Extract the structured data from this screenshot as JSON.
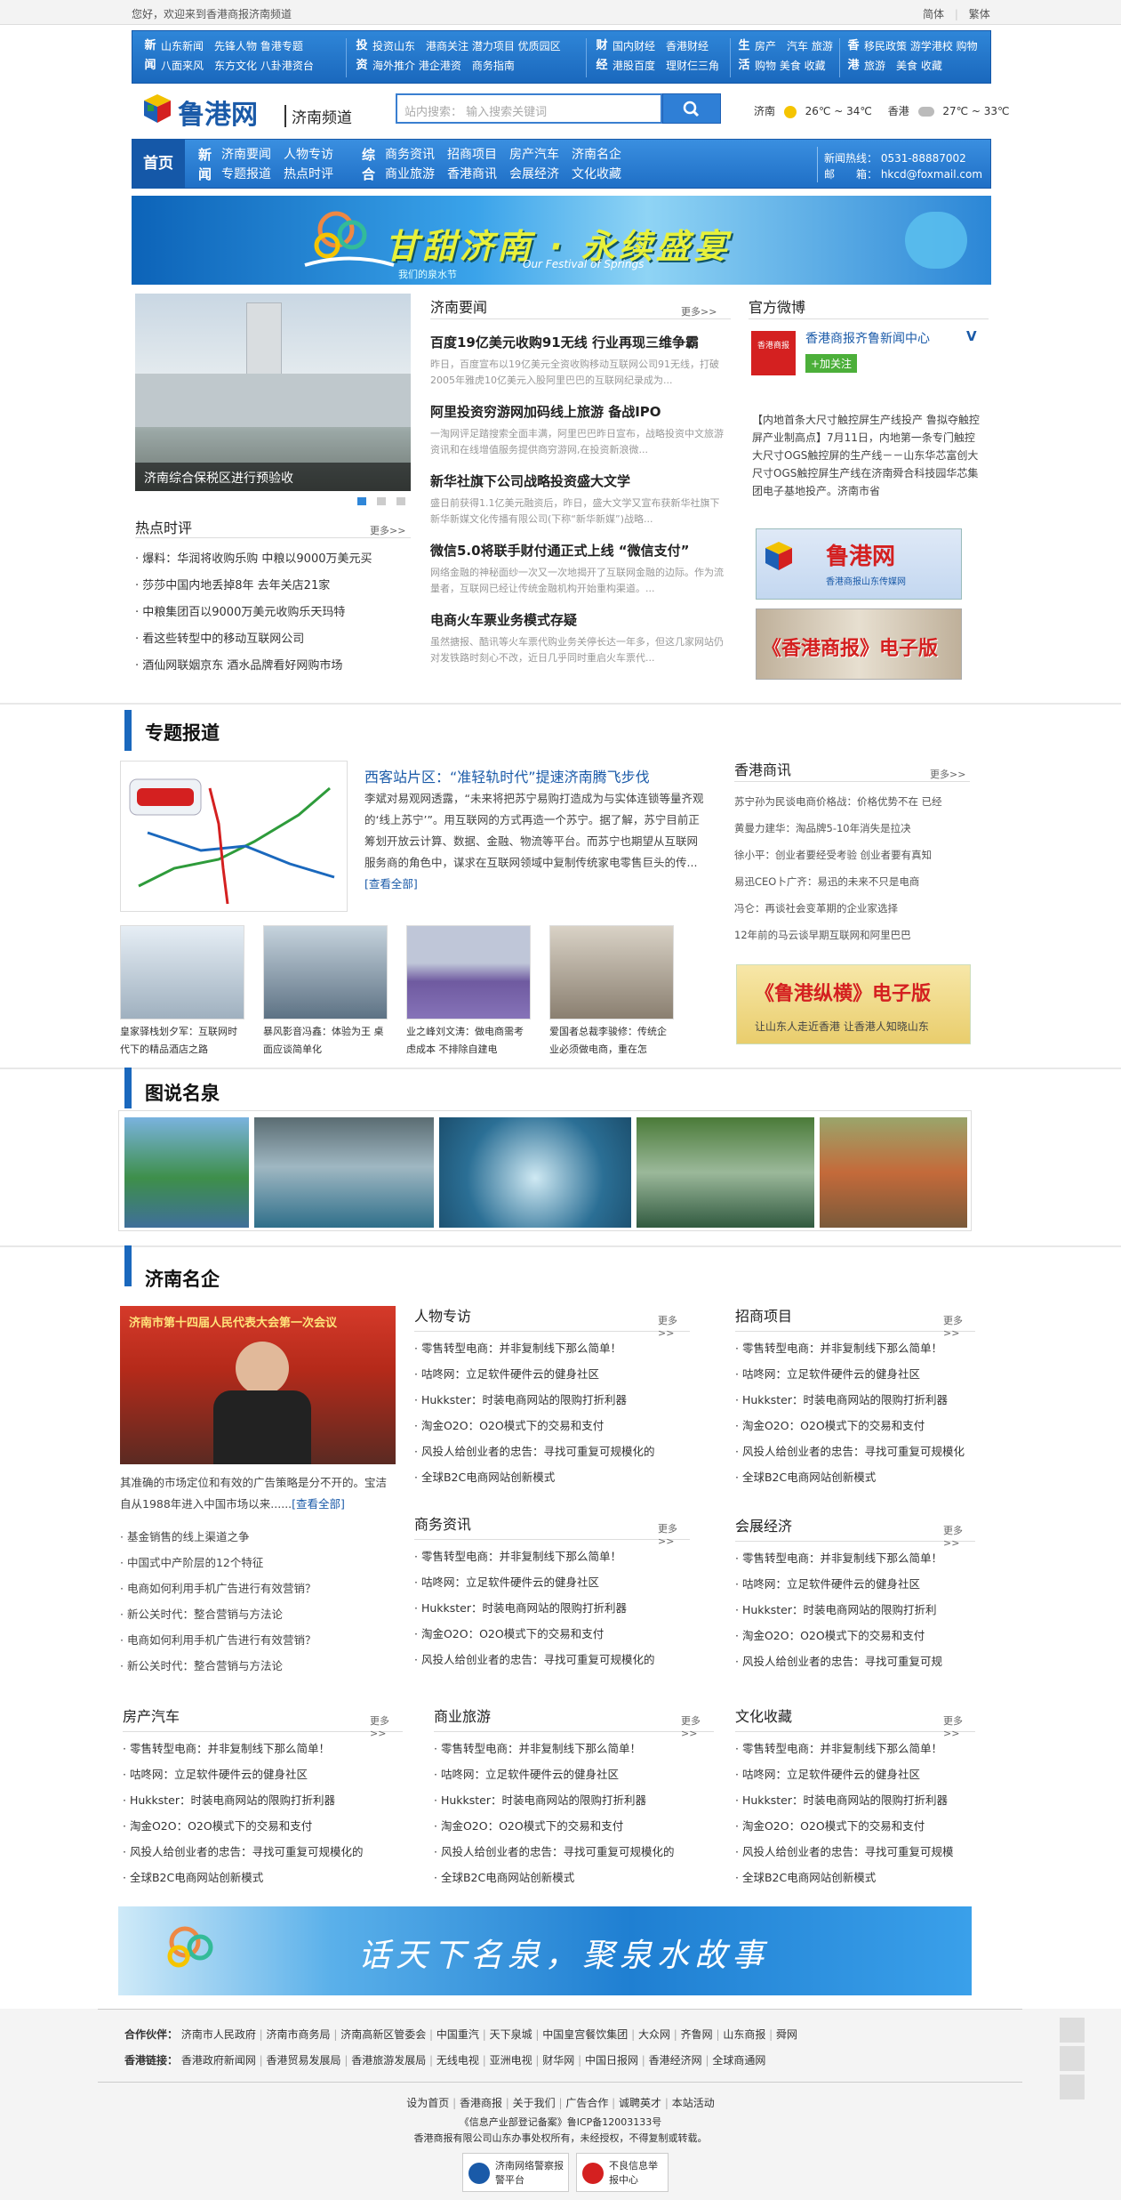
{
  "top": {
    "greeting": "您好，欢迎来到香港商报济南频道",
    "simp": "简体",
    "trad": "繁体"
  },
  "nav": {
    "g1": {
      "k1": "新",
      "k2": "闻",
      "row1": "山东新闻　先锋人物  鲁港专题",
      "row2": "八面来风　东方文化  八卦港资台"
    },
    "g2": {
      "k1": "投",
      "k2": "资",
      "row1": "投资山东　港商关注  潜力项目  优质园区",
      "row2": "海外推介  港企港资　商务指南"
    },
    "g3": {
      "k1": "财",
      "k2": "经",
      "row1": "国内财经　香港财经",
      "row2": "港股百度　理财仨三角"
    },
    "g4": {
      "k1": "生",
      "k2": "活",
      "row1": "房产　汽车  旅游",
      "row2": "购物  美食  收藏"
    },
    "g5": {
      "k1": "香",
      "k2": "港",
      "row1": "移民政策  游学港校  购物",
      "row2": "旅游　美食  收藏"
    }
  },
  "logo": {
    "name": "鲁港网",
    "channel": "济南频道"
  },
  "search": {
    "placeholder": "站内搜索：  输入搜索关键词"
  },
  "weather": {
    "city1": "济南",
    "temp1": "26℃ ~ 34℃",
    "city2": "香港",
    "temp2": "27℃ ~ 33℃"
  },
  "mainnav": {
    "home": "首页",
    "k1": "新",
    "k2": "闻",
    "r1a": "济南要闻",
    "r1b": "人物专访",
    "r2a": "专题报道",
    "r2b": "热点时评",
    "k3": "综",
    "k4": "合",
    "r1c": "商务资讯",
    "r1d": "招商项目",
    "r1e": "房产汽车",
    "r1f": "济南名企",
    "r2c": "商业旅游",
    "r2d": "香港商讯",
    "r2e": "会展经济",
    "r2f": "文化收藏",
    "hotline": "新闻热线：  0531-88887002",
    "email": "邮　　箱：  hkcd@foxmail.com"
  },
  "banner1": {
    "title": "甘甜济南 · 永续盛宴",
    "sub": "Our Festival of Springs",
    "small": "我们的泉水节",
    "logo": "泉水节"
  },
  "photo": {
    "caption": "济南综合保税区进行预验收"
  },
  "news": {
    "title": "济南要闻",
    "more": "更多>>",
    "items": [
      {
        "t": "百度19亿美元收购91无线 行业再现三维争霸",
        "s": "昨日，百度宣布以19亿美元全资收购移动互联网公司91无线，打破2005年雅虎10亿美元入股阿里巴巴的互联网纪录成为..."
      },
      {
        "t": "阿里投资穷游网加码线上旅游 备战IPO",
        "s": "一淘网评足踏搜索全面丰满，阿里巴巴昨日宣布，战略投资中文旅游资讯和在线增值服务提供商穷游网,在投资新浪微..."
      },
      {
        "t": "新华社旗下公司战略投资盛大文学",
        "s": "盛日前获得1.1亿美元融资后，昨日，盛大文学又宣布获新华社旗下新华新媒文化传播有限公司(下称“新华新媒”)战略..."
      },
      {
        "t": "微信5.0将联手财付通正式上线 “微信支付”",
        "s": "网络金融的神秘面纱一次又一次地揭开了互联网金融的边际。作为流量者，互联网已经让传统金融机构开始重构渠道。..."
      },
      {
        "t": "电商火车票业务模式存疑",
        "s": "虽然搪报、酷讯等火车票代购业务关停长达一年多，但这几家网站仍对发铁路时刻心不改，近日几乎同时重启火车票代..."
      }
    ]
  },
  "weibo": {
    "title": "官方微博",
    "name": "香港商报齐鲁新闻中心",
    "follow": "+加关注",
    "avatar": "香港商报",
    "text": "【内地首条大尺寸触控屏生产线投产 鲁拟夺触控屏产业制高点】7月11日，内地第一条专门触控大尺寸OGS触控屏的生产线－－山东华芯富创大尺寸OGS触控屏生产线在济南舜合科技园华芯集团电子基地投产。济南市省",
    "banner_a": "鲁港网",
    "banner_a_sub": "香港商报山东传媒网",
    "banner_b": "《香港商报》电子版"
  },
  "hot": {
    "title": "热点时评",
    "more": "更多>>",
    "items": [
      "爆料：华润将收购乐购 中粮以9000万美元买",
      "莎莎中国内地丢掉8年 去年关店21家",
      "中粮集团百以9000万美元收购乐天玛特",
      "看这些转型中的移动互联网公司",
      "酒仙网联姻京东 酒水品牌看好网购市场"
    ]
  },
  "special": {
    "title": "专题报道",
    "headline": "西客站片区：“准轻轨时代”提速济南腾飞步伐",
    "body": "李斌对易观网透露，“未来将把苏宁易购打造成为与实体连锁等量齐观的‘线上苏宁’”。用互联网的方式再造一个苏宁。据了解，苏宁目前正筹划开放云计算、数据、金融、物流等平台。而苏宁也期望从互联网服务商的角色中，谋求在互联网领域中复制传统家电零售巨头的传...",
    "readall": "[查看全部]",
    "thumbs": [
      "皇家驿栈划夕军：互联网时代下的精品酒店之路",
      "暴风影音冯鑫：体验为王 桌面应谈简单化",
      "业之峰刘文涛：做电商需考虑成本 不排除自建电",
      "爱国者总裁李骏修：传统企业必须做电商，重在怎"
    ]
  },
  "hkinfo": {
    "title": "香港商讯",
    "more": "更多>>",
    "items": [
      "苏宁孙为民谈电商价格战：价格优势不在 已经",
      "黄曼力建华：淘品牌5-10年消失是拉决",
      "徐小平：创业者要经受考验 创业者要有真知",
      "易迅CEO卜广齐：易迅的未来不只是电商",
      "冯仑：再谈社会变革期的企业家选择",
      "12年前的马云谈早期互联网和阿里巴巴"
    ],
    "ebanner": "《鲁港纵横》电子版",
    "ebanner_sub": "让山东人走近香港 让香港人知晓山东"
  },
  "springs": {
    "title": "图说名泉"
  },
  "enterprise": {
    "title": "济南名企",
    "body": "其准确的市场定位和有效的广告策略是分不开的。宝洁自从1988年进入中国市场以来......",
    "readall": "[查看全部]",
    "items": [
      "基金销售的线上渠道之争",
      "中国式中产阶层的12个特征",
      "电商如何利用手机广告进行有效营销？",
      "新公关时代：整合营销与方法论",
      "电商如何利用手机广告进行有效营销？",
      "新公关时代：整合营销与方法论"
    ],
    "bannerText": "济南市第十四届人民代表大会第一次会议"
  },
  "cols": {
    "people": {
      "title": "人物专访",
      "more": "更多>>",
      "items": [
        "零售转型电商：并非复制线下那么简单！",
        "咕咚网：立足软件硬件云的健身社区",
        "Hukkster：时装电商网站的限购打折利器",
        "淘金O2O：O2O模式下的交易和支付",
        "风投人给创业者的忠告：寻找可重复可规模化的",
        "全球B2C电商网站创新模式"
      ]
    },
    "invest": {
      "title": "招商项目",
      "more": "更多>>",
      "items": [
        "零售转型电商：并非复制线下那么简单！",
        "咕咚网：立足软件硬件云的健身社区",
        "Hukkster：时装电商网站的限购打折利器",
        "淘金O2O：O2O模式下的交易和支付",
        "风投人给创业者的忠告：寻找可重复可规模化",
        "全球B2C电商网站创新模式"
      ]
    },
    "biz": {
      "title": "商务资讯",
      "more": "更多>>",
      "items": [
        "零售转型电商：并非复制线下那么简单！",
        "咕咚网：立足软件硬件云的健身社区",
        "Hukkster：时装电商网站的限购打折利器",
        "淘金O2O：O2O模式下的交易和支付",
        "风投人给创业者的忠告：寻找可重复可规模化的"
      ]
    },
    "expo": {
      "title": "会展经济",
      "more": "更多>>",
      "items": [
        "零售转型电商：并非复制线下那么简单！",
        "咕咚网：立足软件硬件云的健身社区",
        "Hukkster：时装电商网站的限购打折利",
        "淘金O2O：O2O模式下的交易和支付",
        "风投人给创业者的忠告：寻找可重复可规"
      ]
    },
    "estate": {
      "title": "房产汽车",
      "more": "更多>>",
      "items": [
        "零售转型电商：并非复制线下那么简单！",
        "咕咚网：立足软件硬件云的健身社区",
        "Hukkster：时装电商网站的限购打折利器",
        "淘金O2O：O2O模式下的交易和支付",
        "风投人给创业者的忠告：寻找可重复可规模化的",
        "全球B2C电商网站创新模式"
      ]
    },
    "travel": {
      "title": "商业旅游",
      "more": "更多>>",
      "items": [
        "零售转型电商：并非复制线下那么简单！",
        "咕咚网：立足软件硬件云的健身社区",
        "Hukkster：时装电商网站的限购打折利器",
        "淘金O2O：O2O模式下的交易和支付",
        "风投人给创业者的忠告：寻找可重复可规模化的",
        "全球B2C电商网站创新模式"
      ]
    },
    "culture": {
      "title": "文化收藏",
      "more": "更多>>",
      "items": [
        "零售转型电商：并非复制线下那么简单！",
        "咕咚网：立足软件硬件云的健身社区",
        "Hukkster：时装电商网站的限购打折利器",
        "淘金O2O：O2O模式下的交易和支付",
        "风投人给创业者的忠告：寻找可重复可规模",
        "全球B2C电商网站创新模式"
      ]
    }
  },
  "banner2": {
    "text": "话天下名泉，聚泉水故事"
  },
  "partners": {
    "label1": "合作伙伴：",
    "links1": [
      "济南市人民政府",
      "济南市商务局",
      "济南高新区管委会",
      "中国重汽",
      "天下泉城",
      "中国皇宫餐饮集团",
      "大众网",
      "齐鲁网",
      "山东商报",
      "舜网"
    ],
    "label2": "香港链接：",
    "links2": [
      "香港政府新闻网",
      "香港贸易发展局",
      "香港旅游发展局",
      "无线电视",
      "亚洲电视",
      "财华网",
      "中国日报网",
      "香港经济网",
      "全球商通网"
    ]
  },
  "footer": {
    "links": [
      "设为首页",
      "香港商报",
      "关于我们",
      "广告合作",
      "诚聘英才",
      "本站活动"
    ],
    "line2": "《信息产业部登记备案》鲁ICP备12003133号",
    "line3": "香港商报有限公司山东办事处权所有，未经授权，不得复制或转载。",
    "badge1": "济南网络警察报警平台",
    "badge2": "不良信息举报中心"
  }
}
